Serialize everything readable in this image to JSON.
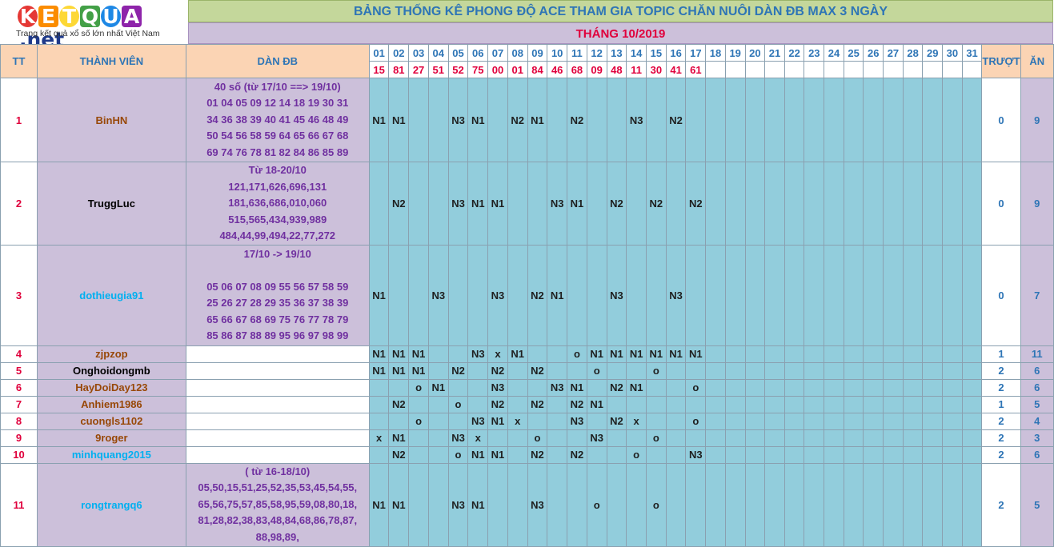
{
  "logo": {
    "letters": [
      "K",
      "E",
      "T",
      "Q",
      "U",
      "A"
    ],
    "suffix": ".net",
    "tagline": "Trang kết quả xổ số lớn nhất Việt Nam",
    "colors": [
      "#e53935",
      "#fb8c00",
      "#fdd835",
      "#43a047",
      "#1e88e5",
      "#8e24aa"
    ]
  },
  "title": "BẢNG THỐNG KÊ PHONG ĐỘ ACE THAM GIA TOPIC CHĂN NUÔI DÀN ĐB MAX 3 NGÀY",
  "month": "THÁNG 10/2019",
  "headers": {
    "tt": "TT",
    "member": "THÀNH VIÊN",
    "dan": "DÀN ĐB",
    "miss": "TRƯỢT",
    "win": "ĂN"
  },
  "days": [
    "01",
    "02",
    "03",
    "04",
    "05",
    "06",
    "07",
    "08",
    "09",
    "10",
    "11",
    "12",
    "13",
    "14",
    "15",
    "16",
    "17",
    "18",
    "19",
    "20",
    "21",
    "22",
    "23",
    "24",
    "25",
    "26",
    "27",
    "28",
    "29",
    "30",
    "31"
  ],
  "results": [
    "15",
    "81",
    "27",
    "51",
    "52",
    "75",
    "00",
    "01",
    "84",
    "46",
    "68",
    "09",
    "48",
    "11",
    "30",
    "41",
    "61",
    "",
    "",
    "",
    "",
    "",
    "",
    "",
    "",
    "",
    "",
    "",
    "",
    "",
    ""
  ],
  "rows": [
    {
      "tt": "1",
      "name": "BinHN",
      "name_color": "#984807",
      "dan": [
        "40 số (từ 17/10 ==> 19/10)",
        "01 04 05 09 12 14 18 19 30 31",
        "34 36 38 39 40 41 45 46 48 49",
        "50 54 56 58 59 64 65 66 67 68",
        "69 74 76 78 81 82 84 86 85 89"
      ],
      "cells": [
        "N1",
        "N1",
        "",
        "",
        "N3",
        "N1",
        "",
        "N2",
        "N1",
        "",
        "N2",
        "",
        "",
        "N3",
        "",
        "N2",
        "",
        "",
        "",
        "",
        "",
        "",
        "",
        "",
        "",
        "",
        "",
        "",
        "",
        "",
        ""
      ],
      "miss": "0",
      "win": "9"
    },
    {
      "tt": "2",
      "name": "TruggLuc",
      "name_color": "#000000",
      "dan": [
        "Từ 18-20/10",
        "121,171,626,696,131",
        "181,636,686,010,060",
        "515,565,434,939,989",
        "484,44,99,494,22,77,272"
      ],
      "cells": [
        "",
        "N2",
        "",
        "",
        "N3",
        "N1",
        "N1",
        "",
        "",
        "N3",
        "N1",
        "",
        "N2",
        "",
        "N2",
        "",
        "N2",
        "",
        "",
        "",
        "",
        "",
        "",
        "",
        "",
        "",
        "",
        "",
        "",
        "",
        ""
      ],
      "miss": "0",
      "win": "9"
    },
    {
      "tt": "3",
      "name": "dothieugia91",
      "name_color": "#00b0f0",
      "dan": [
        "17/10 -> 19/10",
        "",
        "05 06 07 08 09 55 56 57 58 59",
        "25 26 27 28 29 35 36 37 38 39",
        "65 66 67 68 69 75 76 77 78 79",
        "85 86 87 88 89 95 96 97 98 99"
      ],
      "cells": [
        "N1",
        "",
        "",
        "N3",
        "",
        "",
        "N3",
        "",
        "N2",
        "N1",
        "",
        "",
        "N3",
        "",
        "",
        "N3",
        "",
        "",
        "",
        "",
        "",
        "",
        "",
        "",
        "",
        "",
        "",
        "",
        "",
        "",
        ""
      ],
      "miss": "0",
      "win": "7"
    },
    {
      "tt": "4",
      "name": "zjpzop",
      "name_color": "#984807",
      "dan": [],
      "cells": [
        "N1",
        "N1",
        "N1",
        "",
        "",
        "N3",
        "x",
        "N1",
        "",
        "",
        "o",
        "N1",
        "N1",
        "N1",
        "N1",
        "N1",
        "N1",
        "",
        "",
        "",
        "",
        "",
        "",
        "",
        "",
        "",
        "",
        "",
        "",
        "",
        ""
      ],
      "miss": "1",
      "win": "11"
    },
    {
      "tt": "5",
      "name": "Onghoidongmb",
      "name_color": "#000000",
      "dan": [],
      "cells": [
        "N1",
        "N1",
        "N1",
        "",
        "N2",
        "",
        "N2",
        "",
        "N2",
        "",
        "",
        "o",
        "",
        "",
        "o",
        "",
        "",
        "",
        "",
        "",
        "",
        "",
        "",
        "",
        "",
        "",
        "",
        "",
        "",
        "",
        ""
      ],
      "miss": "2",
      "win": "6"
    },
    {
      "tt": "6",
      "name": "HayDoiDay123",
      "name_color": "#984807",
      "dan": [],
      "cells": [
        "",
        "",
        "o",
        "N1",
        "",
        "",
        "N3",
        "",
        "",
        "N3",
        "N1",
        "",
        "N2",
        "N1",
        "",
        "",
        "o",
        "",
        "",
        "",
        "",
        "",
        "",
        "",
        "",
        "",
        "",
        "",
        "",
        "",
        ""
      ],
      "miss": "2",
      "win": "6"
    },
    {
      "tt": "7",
      "name": "Anhiem1986",
      "name_color": "#984807",
      "dan": [],
      "cells": [
        "",
        "N2",
        "",
        "",
        "o",
        "",
        "N2",
        "",
        "N2",
        "",
        "N2",
        "N1",
        "",
        "",
        "",
        "",
        "",
        "",
        "",
        "",
        "",
        "",
        "",
        "",
        "",
        "",
        "",
        "",
        "",
        "",
        ""
      ],
      "miss": "1",
      "win": "5"
    },
    {
      "tt": "8",
      "name": "cuongls1102",
      "name_color": "#984807",
      "dan": [],
      "cells": [
        "",
        "",
        "o",
        "",
        "",
        "N3",
        "N1",
        "x",
        "",
        "",
        "N3",
        "",
        "N2",
        "x",
        "",
        "",
        "o",
        "",
        "",
        "",
        "",
        "",
        "",
        "",
        "",
        "",
        "",
        "",
        "",
        "",
        ""
      ],
      "miss": "2",
      "win": "4"
    },
    {
      "tt": "9",
      "name": "9roger",
      "name_color": "#984807",
      "dan": [],
      "cells": [
        "x",
        "N1",
        "",
        "",
        "N3",
        "x",
        "",
        "",
        "o",
        "",
        "",
        "N3",
        "",
        "",
        "o",
        "",
        "",
        "",
        "",
        "",
        "",
        "",
        "",
        "",
        "",
        "",
        "",
        "",
        "",
        "",
        ""
      ],
      "miss": "2",
      "win": "3"
    },
    {
      "tt": "10",
      "name": "minhquang2015",
      "name_color": "#00b0f0",
      "dan": [],
      "cells": [
        "",
        "N2",
        "",
        "",
        "o",
        "N1",
        "N1",
        "",
        "N2",
        "",
        "N2",
        "",
        "",
        "o",
        "",
        "",
        "N3",
        "",
        "",
        "",
        "",
        "",
        "",
        "",
        "",
        "",
        "",
        "",
        "",
        "",
        ""
      ],
      "miss": "2",
      "win": "6"
    },
    {
      "tt": "11",
      "name": "rongtrangq6",
      "name_color": "#00b0f0",
      "dan": [
        "( từ 16-18/10)",
        "05,50,15,51,25,52,35,53,45,54,55,",
        "65,56,75,57,85,58,95,59,08,80,18,",
        "81,28,82,38,83,48,84,68,86,78,87,",
        "88,98,89,"
      ],
      "cells": [
        "N1",
        "N1",
        "",
        "",
        "N3",
        "N1",
        "",
        "",
        "N3",
        "",
        "",
        "o",
        "",
        "",
        "o",
        "",
        "",
        "",
        "",
        "",
        "",
        "",
        "",
        "",
        "",
        "",
        "",
        "",
        "",
        "",
        ""
      ],
      "miss": "2",
      "win": "5"
    }
  ]
}
